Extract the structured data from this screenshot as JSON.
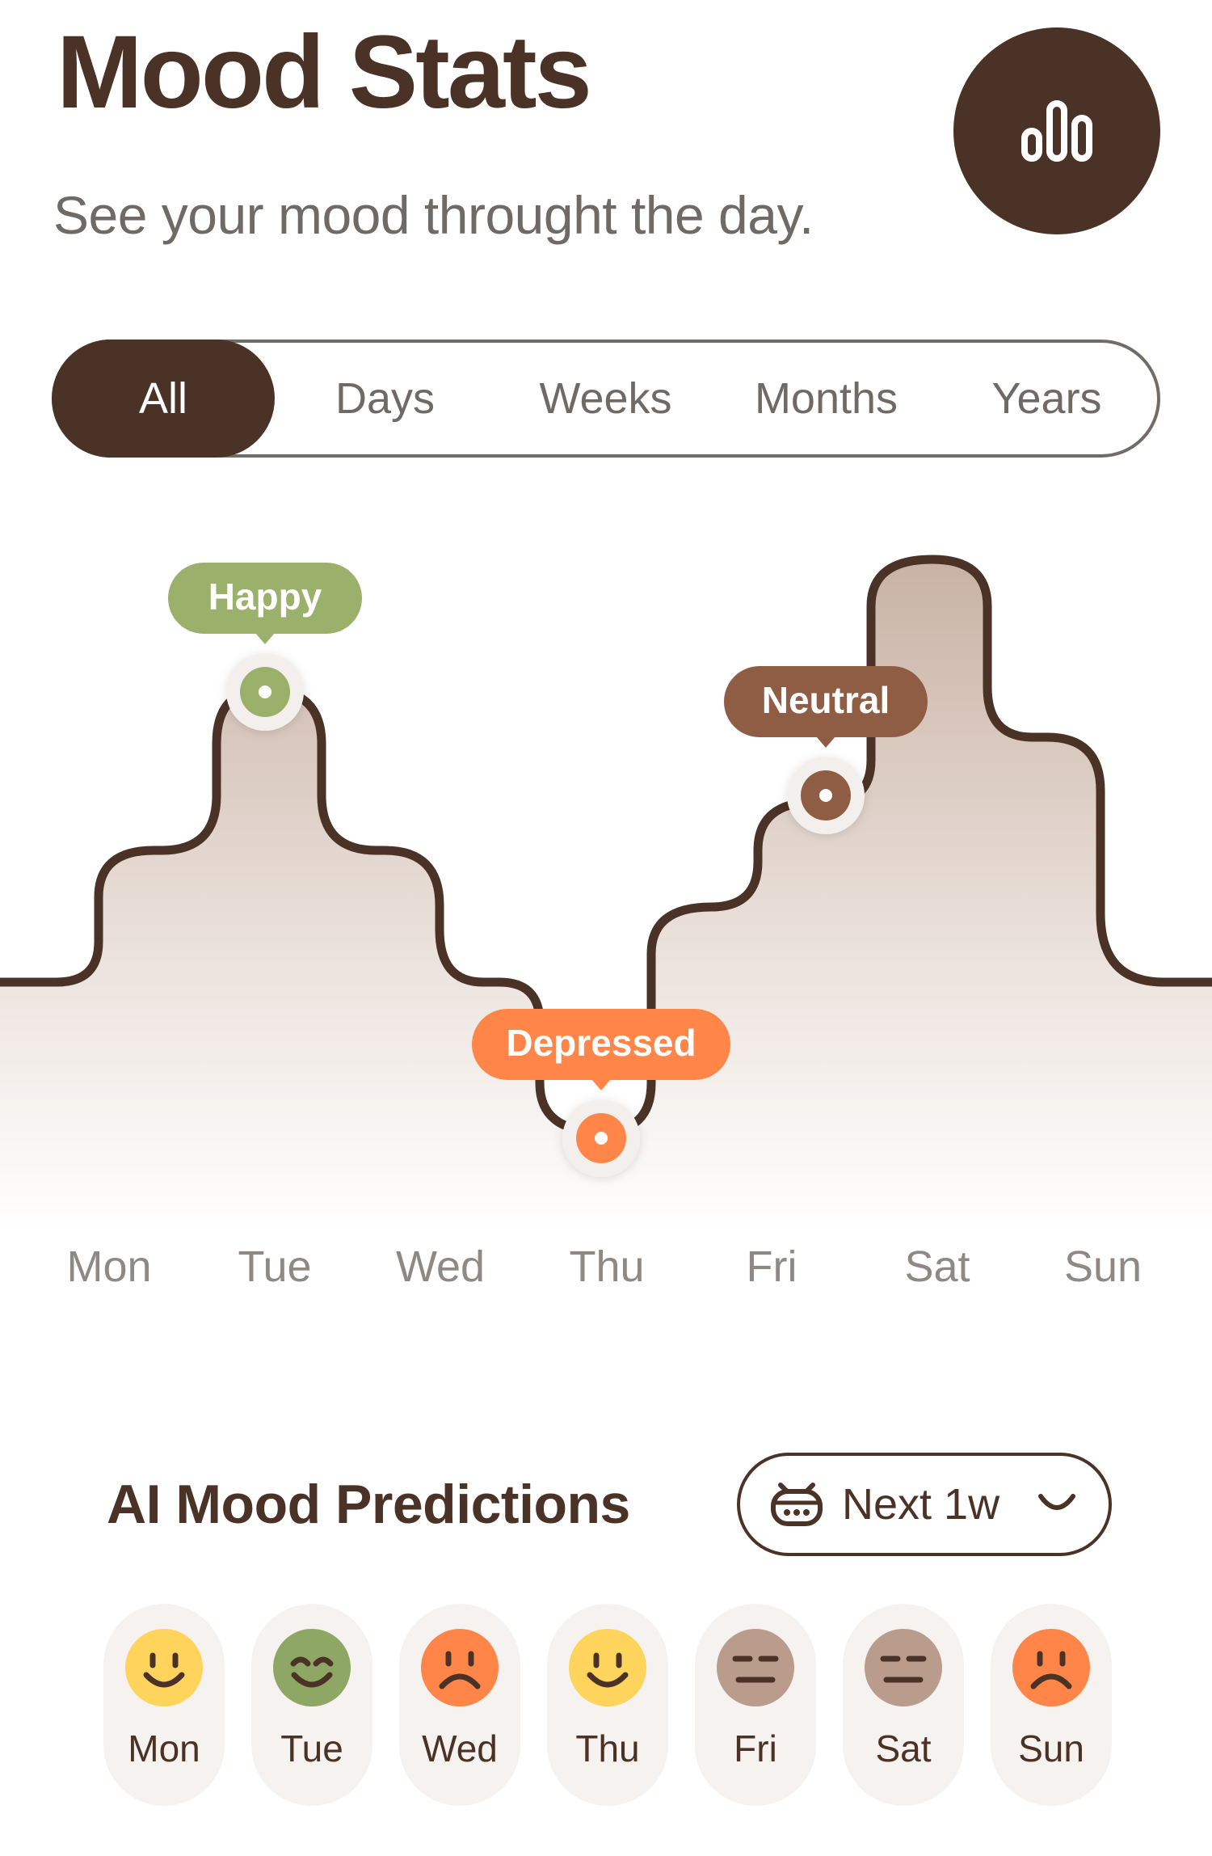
{
  "header": {
    "title": "Mood Stats",
    "subtitle": "See your mood throught the day.",
    "stats_button_icon": "bar-chart-icon"
  },
  "tabs": [
    {
      "label": "All",
      "active": true
    },
    {
      "label": "Days",
      "active": false
    },
    {
      "label": "Weeks",
      "active": false
    },
    {
      "label": "Months",
      "active": false
    },
    {
      "label": "Years",
      "active": false
    }
  ],
  "chart_data": {
    "type": "area",
    "x": [
      "Mon",
      "Tue",
      "Wed",
      "Thu",
      "Fri",
      "Sat",
      "Sun"
    ],
    "annotations": [
      {
        "day": "Tue",
        "label": "Happy",
        "color": "#9bb06a"
      },
      {
        "day": "Thu",
        "label": "Depressed",
        "color": "#ff8549"
      },
      {
        "day": "Fri",
        "label": "Neutral",
        "color": "#8f5d43"
      }
    ],
    "colors": {
      "line": "#4b3226",
      "fill_top": "#c9b2a5",
      "fill_bottom": "#ffffff"
    }
  },
  "predictions": {
    "title": "AI Mood Predictions",
    "period": {
      "label": "Next 1w",
      "icon": "robot-icon",
      "chevron": "chevron-down-icon"
    },
    "days": [
      {
        "day": "Mon",
        "mood": "happy",
        "color": "#ffd45c"
      },
      {
        "day": "Tue",
        "mood": "content",
        "color": "#8fa765"
      },
      {
        "day": "Wed",
        "mood": "sad",
        "color": "#ff8549"
      },
      {
        "day": "Thu",
        "mood": "happy",
        "color": "#ffd45c"
      },
      {
        "day": "Fri",
        "mood": "neutral",
        "color": "#b99c8c"
      },
      {
        "day": "Sat",
        "mood": "neutral",
        "color": "#b99c8c"
      },
      {
        "day": "Sun",
        "mood": "sad",
        "color": "#ff8549"
      }
    ]
  }
}
